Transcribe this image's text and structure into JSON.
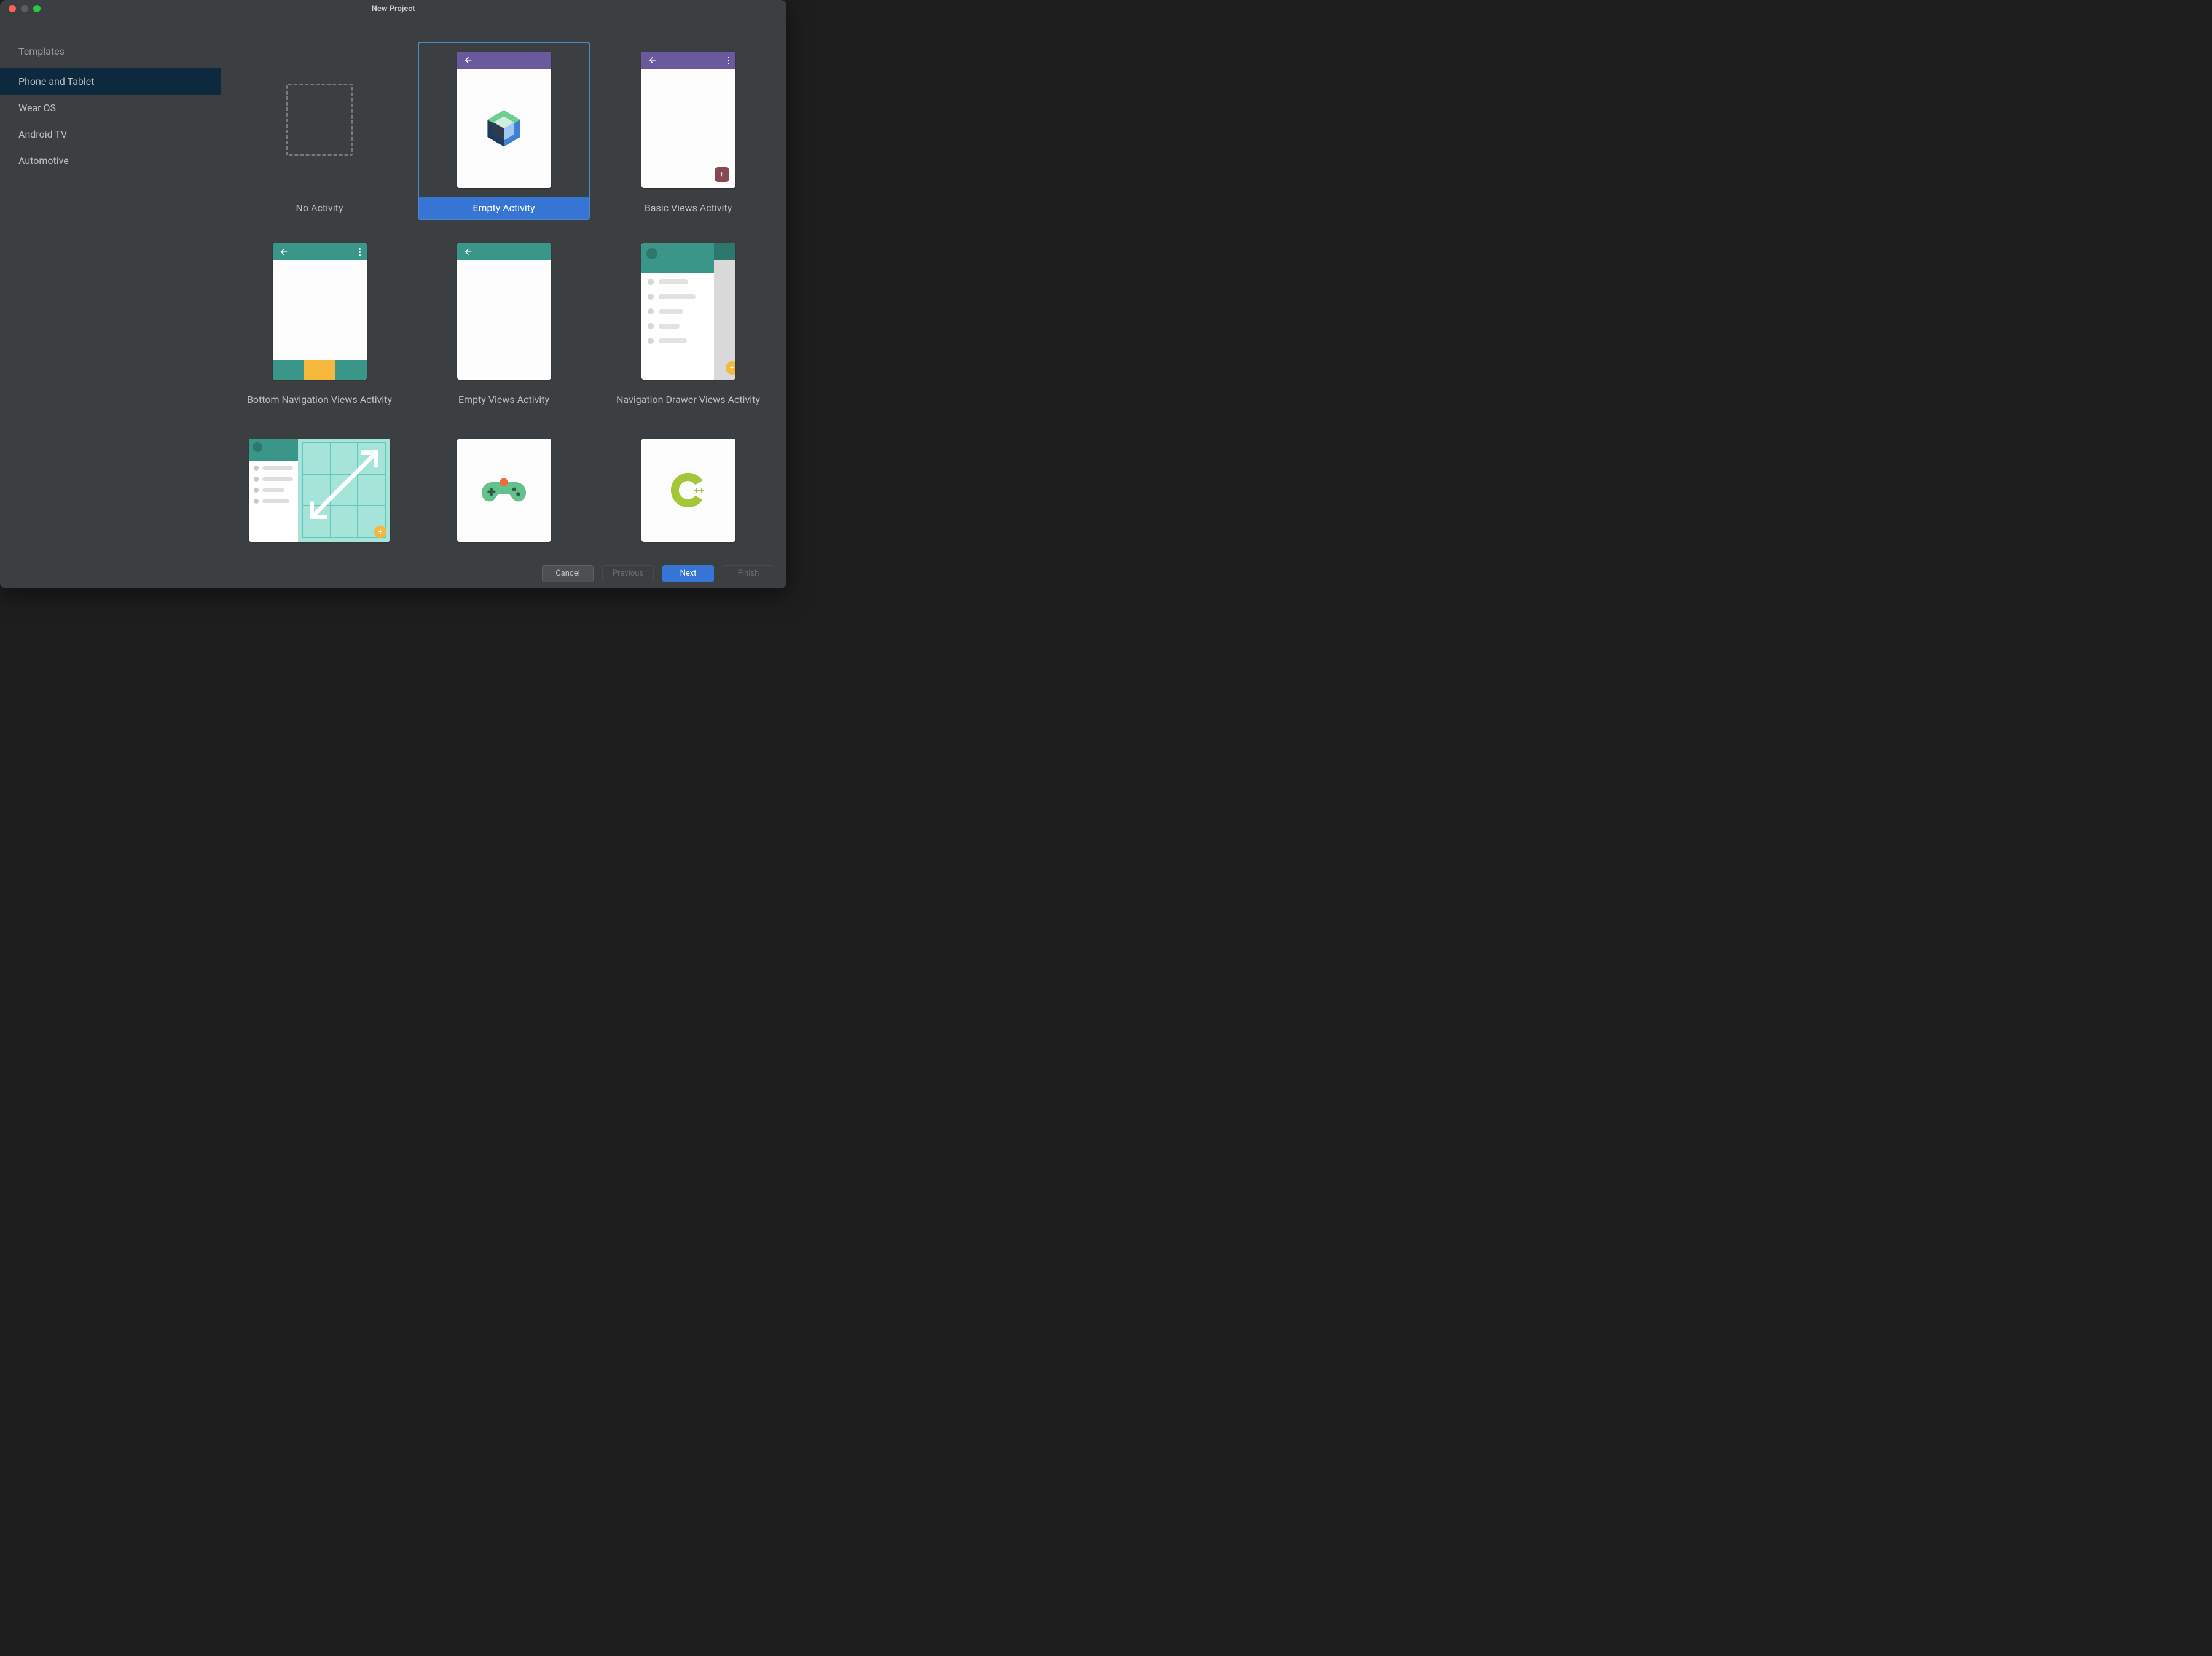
{
  "window": {
    "title": "New Project"
  },
  "sidebar": {
    "heading": "Templates",
    "items": [
      {
        "label": "Phone and Tablet",
        "selected": true
      },
      {
        "label": "Wear OS",
        "selected": false
      },
      {
        "label": "Android TV",
        "selected": false
      },
      {
        "label": "Automotive",
        "selected": false
      }
    ]
  },
  "templates": [
    {
      "id": "no-activity",
      "label": "No Activity",
      "selected": false
    },
    {
      "id": "empty-activity",
      "label": "Empty Activity",
      "selected": true
    },
    {
      "id": "basic-views-activity",
      "label": "Basic Views Activity",
      "selected": false
    },
    {
      "id": "bottom-navigation-views-activity",
      "label": "Bottom Navigation Views Activity",
      "selected": false
    },
    {
      "id": "empty-views-activity",
      "label": "Empty Views Activity",
      "selected": false
    },
    {
      "id": "navigation-drawer-views-activity",
      "label": "Navigation Drawer Views Activity",
      "selected": false
    },
    {
      "id": "responsive-views-activity",
      "label": "",
      "selected": false
    },
    {
      "id": "game-activity",
      "label": "",
      "selected": false
    },
    {
      "id": "native-cpp",
      "label": "",
      "selected": false
    }
  ],
  "footer": {
    "cancel": "Cancel",
    "previous": "Previous",
    "next": "Next",
    "finish": "Finish"
  },
  "colors": {
    "appbar_purple": "#6a599d",
    "appbar_teal": "#3a9688",
    "accent_blue": "#3675d4",
    "fab": "#844953",
    "orange": "#f5b83d",
    "cpp_green": "#a4c639"
  }
}
